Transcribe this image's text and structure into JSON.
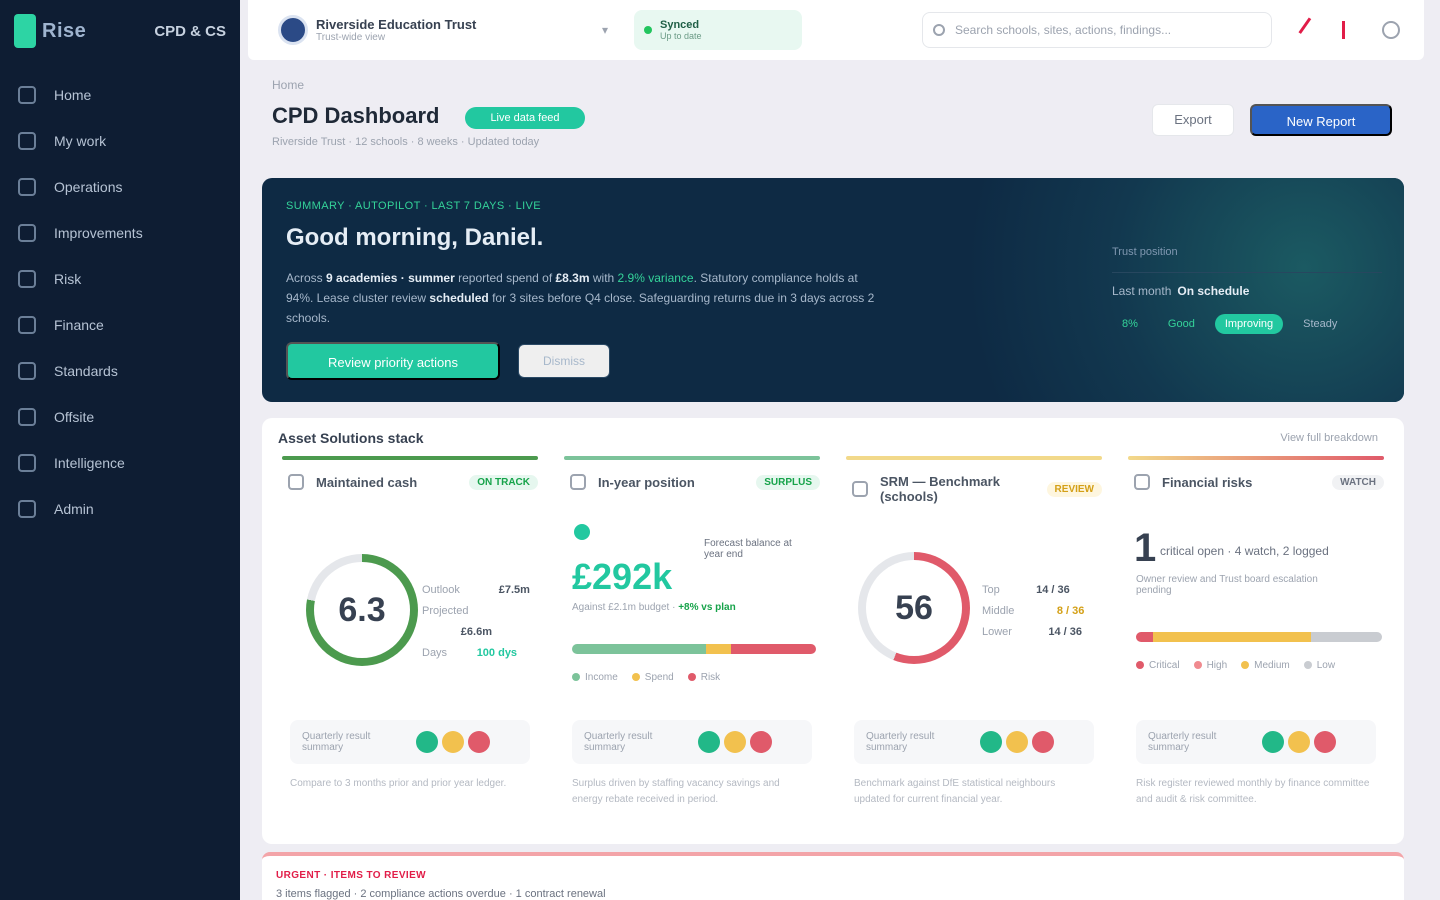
{
  "brand": {
    "name": "Rise",
    "org": "CPD & CS"
  },
  "sidebar": {
    "items": [
      {
        "label": "Home",
        "icon": "home-icon"
      },
      {
        "label": "My work",
        "icon": "briefcase-icon"
      },
      {
        "label": "Operations",
        "icon": "wrench-icon"
      },
      {
        "label": "Improvements",
        "icon": "trend-icon"
      },
      {
        "label": "Risk",
        "icon": "shield-icon"
      },
      {
        "label": "Finance",
        "icon": "coins-icon"
      },
      {
        "label": "Standards",
        "icon": "list-icon"
      },
      {
        "label": "Offsite",
        "icon": "building-icon"
      },
      {
        "label": "Intelligence",
        "icon": "chart-icon"
      },
      {
        "label": "Admin",
        "icon": "gear-icon"
      }
    ]
  },
  "topbar": {
    "site_name": "Riverside Education Trust",
    "site_sub": "Trust-wide view",
    "status_title": "Synced",
    "status_sub": "Up to date",
    "search_placeholder": "Search schools, sites, actions, findings..."
  },
  "page": {
    "breadcrumb": "Home",
    "title": "CPD Dashboard",
    "badge": "Live data feed",
    "subline": "Riverside Trust · 12 schools · 8 weeks · Updated today",
    "export_label": "Export",
    "primary_label": "New Report"
  },
  "hero": {
    "tag": "SUMMARY · AUTOPILOT · LAST 7 DAYS · LIVE",
    "title": "Good morning, Daniel.",
    "body_1": "Across ",
    "body_1b": "9 academies · summer",
    "body_2": " reported spend of ",
    "body_2b": "£8.3m",
    "body_3": " with ",
    "body_3g": "2.9% variance",
    "body_4": ". Statutory compliance holds at 94%. Lease cluster review ",
    "body_4b": "scheduled",
    "body_5": " for 3 sites before Q4 close. Safeguarding returns due in 3 days across 2 schools.",
    "cta": "Review priority actions",
    "secondary": "Dismiss",
    "side_label": "Trust position",
    "side_stat_label": "Last month",
    "side_stat_value": "On schedule",
    "chips": [
      "8%",
      "Good",
      "Improving",
      "Steady"
    ]
  },
  "health": {
    "title": "Asset Solutions stack",
    "link": "View full breakdown"
  },
  "kpis": [
    {
      "name": "Maintained cash",
      "badge": "ON TRACK",
      "value": "6.3",
      "rows": [
        [
          "Outlook",
          "£7.5m"
        ],
        [
          "Projected",
          "£6.6m"
        ],
        [
          "Days",
          "100 dys"
        ]
      ],
      "rag_text": "Quarterly result summary",
      "foot": "Compare to 3 months prior and prior year ledger."
    },
    {
      "name": "In-year position",
      "badge": "SURPLUS",
      "value": "£292k",
      "label": "Forecast balance at year end",
      "line_a": "Against £2.1m budget · ",
      "line_b": "+8% vs plan",
      "legend": [
        "Income",
        "Spend",
        "Risk"
      ],
      "rag_text": "Quarterly result summary",
      "foot": "Surplus driven by staffing vacancy savings and energy rebate received in period."
    },
    {
      "name": "SRM — Benchmark (schools)",
      "badge": "REVIEW",
      "value": "56",
      "rows": [
        [
          "Top",
          "14 / 36"
        ],
        [
          "Middle",
          "8 / 36"
        ],
        [
          "Lower",
          "14 / 36"
        ]
      ],
      "rag_text": "Quarterly result summary",
      "foot": "Benchmark against DfE statistical neighbours updated for current financial year."
    },
    {
      "name": "Financial risks",
      "badge": "WATCH",
      "value": "1",
      "text": "critical open · 4 watch, 2 logged",
      "sub": "Owner review and Trust board escalation pending",
      "legend": [
        "Critical",
        "High",
        "Medium",
        "Low"
      ],
      "rag_text": "Quarterly result summary",
      "foot": "Risk register reviewed monthly by finance committee and audit & risk committee."
    }
  ],
  "alert": {
    "title": "URGENT · ITEMS TO REVIEW",
    "text": "3 items flagged · 2 compliance actions overdue · 1 contract renewal"
  },
  "colors": {
    "sidebar_bg": "#0e1d33",
    "accent": "#22c8a0",
    "primary": "#2a64c7",
    "ring_green": "#4c9a4e",
    "ring_red": "#e05a6a",
    "amber": "#f2c14e"
  }
}
